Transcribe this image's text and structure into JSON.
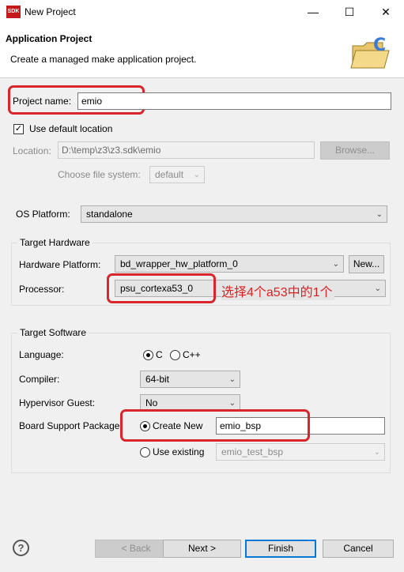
{
  "window": {
    "title": "New Project",
    "app_icon_text": "SDK",
    "minimize_glyph": "—",
    "maximize_glyph": "☐",
    "close_glyph": "✕"
  },
  "header": {
    "title": "Application Project",
    "subtitle": "Create a managed make application project."
  },
  "project": {
    "name_label": "Project name:",
    "name_value": "emio",
    "use_default_location_label": "Use default location",
    "use_default_location_checked": true,
    "location_label": "Location:",
    "location_value": "D:\\temp\\z3\\z3.sdk\\emio",
    "browse_label": "Browse...",
    "file_system_label": "Choose file system:",
    "file_system_value": "default"
  },
  "os_platform": {
    "label": "OS Platform:",
    "value": "standalone"
  },
  "target_hardware": {
    "group_title": "Target Hardware",
    "hardware_platform_label": "Hardware Platform:",
    "hardware_platform_value": "bd_wrapper_hw_platform_0",
    "new_button_label": "New...",
    "processor_label": "Processor:",
    "processor_value": "psu_cortexa53_0",
    "annotation": "选择4个a53中的1个"
  },
  "target_software": {
    "group_title": "Target Software",
    "language_label": "Language:",
    "language_options": [
      "C",
      "C++"
    ],
    "language_selected": "C",
    "compiler_label": "Compiler:",
    "compiler_value": "64-bit",
    "hypervisor_label": "Hypervisor Guest:",
    "hypervisor_value": "No",
    "bsp_label": "Board Support Package:",
    "create_new_label": "Create New",
    "create_new_value": "emio_bsp",
    "use_existing_label": "Use existing",
    "use_existing_value": "emio_test_bsp"
  },
  "footer": {
    "help_glyph": "?",
    "back_label": "< Back",
    "next_label": "Next >",
    "finish_label": "Finish",
    "cancel_label": "Cancel"
  },
  "icons": [
    "sdk-app-icon",
    "c-project-folder-icon",
    "help-icon",
    "chevron-down-icon",
    "checkmark-icon"
  ],
  "colors": {
    "annotation_red": "#d9262c",
    "focus_blue": "#0078d7"
  }
}
